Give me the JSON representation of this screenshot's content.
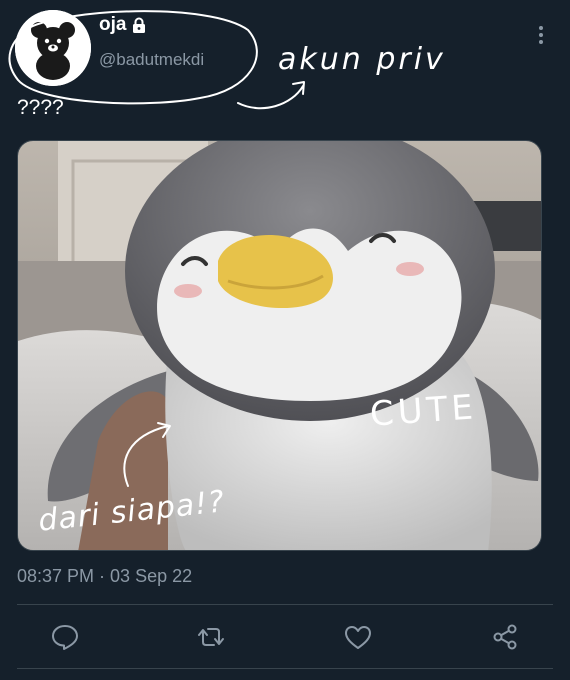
{
  "tweet": {
    "author_name": "oja",
    "handle": "@badutmekdi",
    "text": "????",
    "timestamp": "08:37 PM · 03 Sep 22"
  },
  "annotations": {
    "top": "akun priv",
    "photo_right": "CUTE",
    "photo_left": "dari siapa!?"
  },
  "icons": {
    "lock": "lock-icon",
    "more": "more-vertical-icon",
    "reply": "reply-icon",
    "retweet": "retweet-icon",
    "like": "like-icon",
    "share": "share-icon"
  },
  "colors": {
    "background": "#15202b",
    "secondary_text": "#8b98a5",
    "divider": "#38444d"
  }
}
